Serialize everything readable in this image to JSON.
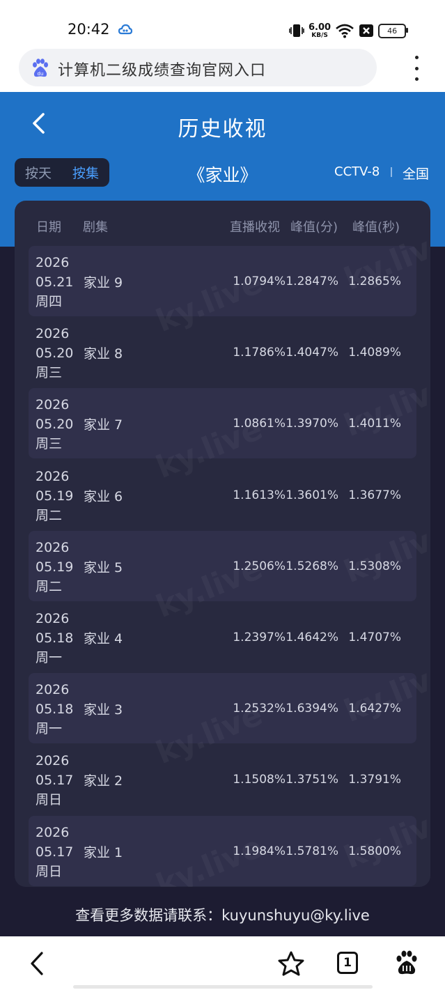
{
  "status_bar": {
    "time": "20:42",
    "net_speed_value": "6.00",
    "net_speed_unit": "KB/S",
    "battery": "46"
  },
  "browser": {
    "address": "计算机二级成绩查询官网入口"
  },
  "header": {
    "title": "历史收视"
  },
  "toggle": {
    "by_day": "按天",
    "by_episode": "按集"
  },
  "show": {
    "title": "《家业》",
    "channel": "CCTV-8",
    "region": "全国"
  },
  "table": {
    "headers": {
      "date": "日期",
      "episode": "剧集",
      "live": "直播收视",
      "peak_min": "峰值(分)",
      "peak_sec": "峰值(秒)"
    },
    "rows": [
      {
        "year": "2026",
        "date": "05.21",
        "weekday": "周四",
        "episode": "家业 9",
        "live": "1.0794%",
        "peak_min": "1.2847%",
        "peak_sec": "1.2865%"
      },
      {
        "year": "2026",
        "date": "05.20",
        "weekday": "周三",
        "episode": "家业 8",
        "live": "1.1786%",
        "peak_min": "1.4047%",
        "peak_sec": "1.4089%"
      },
      {
        "year": "2026",
        "date": "05.20",
        "weekday": "周三",
        "episode": "家业 7",
        "live": "1.0861%",
        "peak_min": "1.3970%",
        "peak_sec": "1.4011%"
      },
      {
        "year": "2026",
        "date": "05.19",
        "weekday": "周二",
        "episode": "家业 6",
        "live": "1.1613%",
        "peak_min": "1.3601%",
        "peak_sec": "1.3677%"
      },
      {
        "year": "2026",
        "date": "05.19",
        "weekday": "周二",
        "episode": "家业 5",
        "live": "1.2506%",
        "peak_min": "1.5268%",
        "peak_sec": "1.5308%"
      },
      {
        "year": "2026",
        "date": "05.18",
        "weekday": "周一",
        "episode": "家业 4",
        "live": "1.2397%",
        "peak_min": "1.4642%",
        "peak_sec": "1.4707%"
      },
      {
        "year": "2026",
        "date": "05.18",
        "weekday": "周一",
        "episode": "家业 3",
        "live": "1.2532%",
        "peak_min": "1.6394%",
        "peak_sec": "1.6427%"
      },
      {
        "year": "2026",
        "date": "05.17",
        "weekday": "周日",
        "episode": "家业 2",
        "live": "1.1508%",
        "peak_min": "1.3751%",
        "peak_sec": "1.3791%"
      },
      {
        "year": "2026",
        "date": "05.17",
        "weekday": "周日",
        "episode": "家业 1",
        "live": "1.1984%",
        "peak_min": "1.5781%",
        "peak_sec": "1.5800%"
      }
    ]
  },
  "watermark": "ky.live",
  "footer": {
    "contact": "查看更多数据请联系：kuyunshuyu@ky.live"
  },
  "nav": {
    "tab_count": "1"
  },
  "icons": [
    "cloud-icon",
    "vibrate-icon",
    "wifi-icon",
    "close-box-icon",
    "battery-icon",
    "baidu-icon",
    "more-icon",
    "back-icon",
    "star-icon",
    "tabs-icon",
    "paw-icon"
  ],
  "colors": {
    "header_blue": "#1f72c6",
    "page_dark": "#1d1c32",
    "card": "#28293f",
    "row_alt": "#30304b",
    "accent": "#4a9fff"
  }
}
